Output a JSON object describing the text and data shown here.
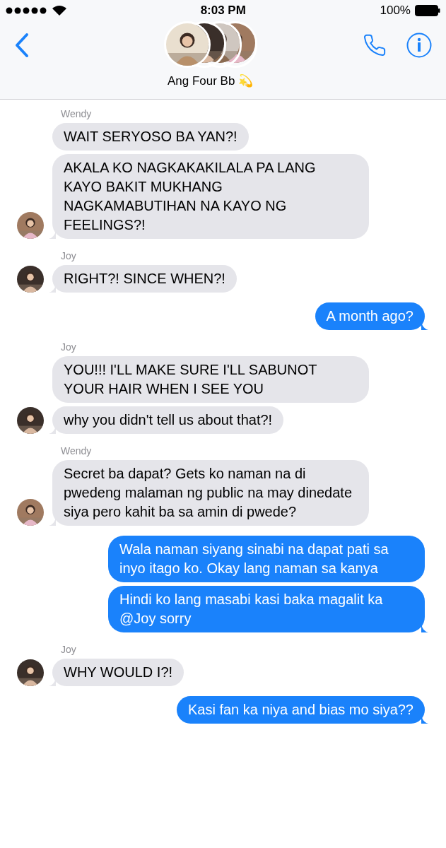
{
  "status_bar": {
    "time": "8:03 PM",
    "battery": "100%"
  },
  "header": {
    "title": "Ang Four Bb 💫"
  },
  "groups": [
    {
      "kind": "incoming",
      "sender": "Wendy",
      "messages": [
        "WAIT SERYOSO BA YAN?!",
        "AKALA KO NAGKAKAKILALA PA LANG KAYO BAKIT MUKHANG NAGKAMABUTIHAN NA KAYO NG FEELINGS?!"
      ]
    },
    {
      "kind": "incoming",
      "sender": "Joy",
      "messages": [
        "RIGHT?! SINCE WHEN?!"
      ]
    },
    {
      "kind": "outgoing",
      "messages": [
        "A month ago?"
      ]
    },
    {
      "kind": "incoming",
      "sender": "Joy",
      "messages": [
        "YOU!!! I'LL MAKE SURE I'LL SABUNOT YOUR HAIR WHEN I SEE YOU",
        "why you didn't tell us about that?!"
      ]
    },
    {
      "kind": "incoming",
      "sender": "Wendy",
      "messages": [
        "Secret ba dapat? Gets ko naman na di pwedeng malaman ng public na may dinedate siya pero kahit ba sa amin di pwede?"
      ]
    },
    {
      "kind": "outgoing",
      "messages": [
        "Wala naman siyang sinabi na dapat pati sa inyo itago ko. Okay lang naman sa kanya",
        "Hindi ko lang masabi kasi baka magalit ka @Joy sorry"
      ]
    },
    {
      "kind": "incoming",
      "sender": "Joy",
      "messages": [
        "WHY WOULD I?!"
      ]
    },
    {
      "kind": "outgoing",
      "messages": [
        "Kasi fan ka niya and bias mo siya??"
      ]
    }
  ]
}
